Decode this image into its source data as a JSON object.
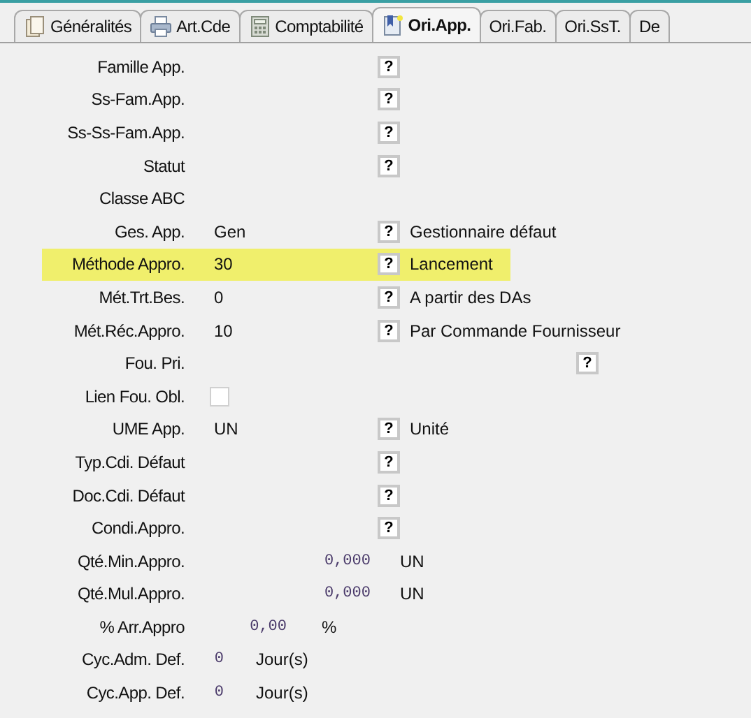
{
  "tabs": [
    {
      "label": "Généralités",
      "kind": "documents",
      "selected": false
    },
    {
      "label": "Art.Cde",
      "kind": "printer",
      "selected": false
    },
    {
      "label": "Comptabilité",
      "kind": "calculator",
      "selected": false
    },
    {
      "label": "Ori.App.",
      "kind": "bookmark",
      "selected": true
    },
    {
      "label": "Ori.Fab.",
      "kind": "plain",
      "selected": false
    },
    {
      "label": "Ori.SsT.",
      "kind": "plain",
      "selected": false
    },
    {
      "label": "De",
      "kind": "plain",
      "selected": false
    }
  ],
  "rows": [
    {
      "kind": "lookup",
      "label": "Famille App.",
      "help": "?",
      "highlighted": false
    },
    {
      "kind": "lookup",
      "label": "Ss-Fam.App.",
      "help": "?",
      "highlighted": false
    },
    {
      "kind": "lookup",
      "label": "Ss-Ss-Fam.App.",
      "help": "?",
      "highlighted": false
    },
    {
      "kind": "lookup",
      "label": "Statut",
      "help": "?",
      "highlighted": false
    },
    {
      "kind": "plain",
      "label": "Classe ABC",
      "highlighted": false
    },
    {
      "kind": "lookup",
      "label": "Ges. App.",
      "value": "Gen",
      "help": "?",
      "description": "Gestionnaire défaut",
      "highlighted": false
    },
    {
      "kind": "lookup",
      "label": "Méthode Appro.",
      "value": "30",
      "help": "?",
      "description": "Lancement",
      "highlighted": true
    },
    {
      "kind": "lookup",
      "label": "Mét.Trt.Bes.",
      "value": "0",
      "help": "?",
      "description": "A partir des DAs",
      "highlighted": false
    },
    {
      "kind": "lookup",
      "label": "Mét.Réc.Appro.",
      "value": "10",
      "help": "?",
      "description": "Par Commande Fournisseur",
      "highlighted": false
    },
    {
      "kind": "supplier",
      "label": "Fou. Pri.",
      "help": "?",
      "highlighted": false
    },
    {
      "kind": "checkbox",
      "label": "Lien Fou. Obl.",
      "checked": false,
      "highlighted": false
    },
    {
      "kind": "lookup",
      "label": "UME App.",
      "value": "UN",
      "help": "?",
      "description": "Unité",
      "highlighted": false
    },
    {
      "kind": "lookup",
      "label": "Typ.Cdi. Défaut",
      "help": "?",
      "highlighted": false
    },
    {
      "kind": "lookup",
      "label": "Doc.Cdi. Défaut",
      "help": "?",
      "highlighted": false
    },
    {
      "kind": "lookup",
      "label": "Condi.Appro.",
      "help": "?",
      "highlighted": false
    },
    {
      "kind": "quantity",
      "label": "Qté.Min.Appro.",
      "value": "0,000",
      "unit": "UN",
      "highlighted": false
    },
    {
      "kind": "quantity",
      "label": "Qté.Mul.Appro.",
      "value": "0,000",
      "unit": "UN",
      "highlighted": false
    },
    {
      "kind": "percent",
      "label": "% Arr.Appro",
      "value": "0,00",
      "unit": "%",
      "highlighted": false
    },
    {
      "kind": "days",
      "label": "Cyc.Adm. Def.",
      "value": "0",
      "unit": "Jour(s)",
      "highlighted": false
    },
    {
      "kind": "days",
      "label": "Cyc.App. Def.",
      "value": "0",
      "unit": "Jour(s)",
      "highlighted": false
    }
  ]
}
